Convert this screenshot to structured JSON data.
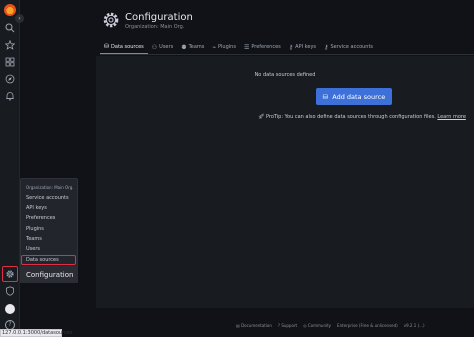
{
  "header": {
    "title": "Configuration",
    "subtitle": "Organization: Main Org."
  },
  "tabs": [
    {
      "label": "Data sources",
      "icon": "database-icon",
      "active": true
    },
    {
      "label": "Users",
      "icon": "user-icon",
      "active": false
    },
    {
      "label": "Teams",
      "icon": "users-icon",
      "active": false
    },
    {
      "label": "Plugins",
      "icon": "plug-icon",
      "active": false
    },
    {
      "label": "Preferences",
      "icon": "sliders-icon",
      "active": false
    },
    {
      "label": "API keys",
      "icon": "key-icon",
      "active": false
    },
    {
      "label": "Service accounts",
      "icon": "key-skeleton-icon",
      "active": false
    }
  ],
  "empty_state": {
    "title": "No data sources defined",
    "button_label": "Add data source",
    "protip_text": "ProTip: You can also define data sources through configuration files.",
    "protip_link": "Learn more"
  },
  "flyout": {
    "header": "Organization: Main Org.",
    "items": [
      "Service accounts",
      "API keys",
      "Preferences",
      "Plugins",
      "Teams",
      "Users",
      "Data sources"
    ],
    "active_item": "Data sources",
    "footer_label": "Configuration"
  },
  "footer": {
    "documentation": "Documentation",
    "support": "Support",
    "community": "Community",
    "edition": "Enterprise (Free & unlicensed)",
    "version": "v9.2.1 (...)"
  },
  "statusbar": {
    "url": "127.0.0.1:3000/datasources"
  },
  "colors": {
    "accent_tab": "#f55f3e",
    "primary_button": "#3d71d9",
    "highlight": "#e02f44"
  }
}
